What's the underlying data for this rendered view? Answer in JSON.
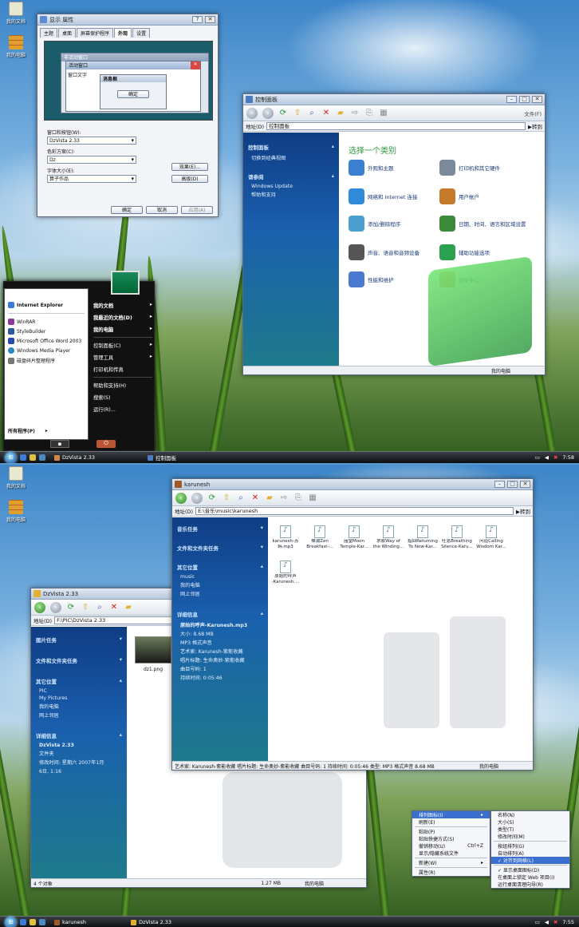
{
  "screen1": {
    "desktop_icons": [
      "我的文档",
      "我的电脑"
    ],
    "display_dialog": {
      "title": "显示 属性",
      "tabs": [
        "主题",
        "桌面",
        "屏幕保护程序",
        "外观",
        "设置"
      ],
      "active_tab": "外观",
      "preview": {
        "inactive": "非活动窗口",
        "active": "活动窗口",
        "text": "窗口文字",
        "msgbox": "消息框",
        "ok": "确定"
      },
      "label_windows": "窗口和按钮(W):",
      "value_windows": "DzVista 2.33",
      "label_scheme": "色彩方案(C):",
      "value_scheme": "Dz",
      "label_font": "字体大小(E):",
      "value_font": "算子作品",
      "btn_effects": "效果(E)...",
      "btn_advanced": "高级(D)",
      "btn_ok": "确定",
      "btn_cancel": "取消",
      "btn_apply": "应用(A)"
    },
    "control_panel": {
      "title": "控制面板",
      "address_label": "地址(D)",
      "address": "控制面板",
      "go": "转到",
      "file_menu": "文件(F)",
      "left_header": "控制面板",
      "switch_view": "切换到经典视图",
      "see_also_header": "请参阅",
      "see_also": [
        "Windows Update",
        "帮助和支持"
      ],
      "heading": "选择一个类别",
      "categories": [
        {
          "label": "外观和主题",
          "color": "#3a7fd0"
        },
        {
          "label": "打印机和其它硬件",
          "color": "#7a8a9a"
        },
        {
          "label": "网络和 Internet 连接",
          "color": "#2f8ad8"
        },
        {
          "label": "用户帐户",
          "color": "#c47a2a"
        },
        {
          "label": "添加/删除程序",
          "color": "#4aa0d0"
        },
        {
          "label": "日期、时间、语言和区域设置",
          "color": "#3a8a3a"
        },
        {
          "label": "声音、语音和音频设备",
          "color": "#555"
        },
        {
          "label": "辅助功能选项",
          "color": "#2aa050"
        },
        {
          "label": "性能和维护",
          "color": "#4a7ad0"
        },
        {
          "label": "安全中心",
          "color": "#d0a030"
        }
      ],
      "status": "我的电脑"
    },
    "start_menu": {
      "pinned": [
        "Internet Explorer"
      ],
      "recent": [
        "WinRAR",
        "StyleBuilder",
        "Microsoft Office Word 2003",
        "Windows Media Player",
        "磁盘碎片整理程序"
      ],
      "all_programs": "所有程序(P)",
      "right": [
        "我的文档",
        "我最近的文档(D)",
        "我的电脑",
        "控制面板(C)",
        "管理工具",
        "打印机和传真",
        "帮助和支持(H)",
        "搜索(S)",
        "运行(R)..."
      ]
    },
    "taskbar": {
      "tasks": [
        "DzVista 2.33",
        "控制面板"
      ],
      "time": "7:58"
    }
  },
  "screen2": {
    "desktop_icons": [
      "我的文档",
      "我的电脑"
    ],
    "music_window": {
      "title": "karunesh",
      "address_label": "地址(D)",
      "address": "E:\\音乐\\music\\karunesh",
      "go": "转到",
      "sections": [
        {
          "header": "音乐任务",
          "items": []
        },
        {
          "header": "文件和文件夹任务",
          "items": []
        },
        {
          "header": "其它位置",
          "items": [
            "music",
            "我的电脑",
            "网上邻居"
          ]
        }
      ],
      "details_header": "详细信息",
      "details_title": "原始的呼声-Karunesh.mp3",
      "details": [
        "大小: 8.68 MB",
        "MP3 格式声音",
        "艺术家: Karunesh-紫能收藏",
        "唱片标题: 生命奥妙-紫能收藏",
        "曲目号码: 1",
        "持续时间: 0:05:46"
      ],
      "files": [
        [
          "karunesh-苏",
          "韩.mp3"
        ],
        [
          "禅潮Zen",
          "Breakfast-..."
        ],
        [
          "庙堂Moon",
          "Temple-Kar..."
        ],
        [
          "求索Way of",
          "the Winding..."
        ],
        [
          "指回Returning",
          "To Now-Kar..."
        ],
        [
          "吐息Breathing",
          "Silence-Karu..."
        ],
        [
          "问道Calling",
          "Wisdom Kar..."
        ],
        [
          "原始的呼声",
          "-Karunesh...."
        ]
      ],
      "status": "艺术家: Karunesh-紫能收藏 唱片标题: 生命奥妙-紫能收藏 曲目号码: 1 持续时间: 0:05:46 类型: MP3 格式声音 8.68 MB",
      "status_right": "我的电脑"
    },
    "pic_window": {
      "title": "DzVista 2.33",
      "address_label": "地址(D)",
      "address": "F:\\PIC\\DzVista 2.33",
      "sections": [
        {
          "header": "图片任务",
          "items": []
        },
        {
          "header": "文件和文件夹任务",
          "items": []
        },
        {
          "header": "其它位置",
          "items": [
            "PIC",
            "My Pictures",
            "我的电脑",
            "网上邻居"
          ]
        }
      ],
      "details_header": "详细信息",
      "details_title": "DzVista 2.33",
      "details": [
        "文件夹",
        "修改时间: 星期六 2007年1月",
        "6日, 1:16"
      ],
      "file": "dz1.png",
      "status_left": "4 个对象",
      "status_size": "1.27 MB",
      "status_right": "我的电脑"
    },
    "context_menu": {
      "items": [
        {
          "label": "排列图标(I)",
          "arrow": true,
          "hl": true
        },
        {
          "label": "刷新(E)"
        },
        {
          "sep": true
        },
        {
          "label": "粘贴(P)"
        },
        {
          "label": "粘贴快捷方式(S)"
        },
        {
          "label": "撤销移动(U)",
          "shortcut": "Ctrl+Z"
        },
        {
          "label": "显示/隐藏系统文件"
        },
        {
          "sep": true
        },
        {
          "label": "新建(W)",
          "arrow": true
        },
        {
          "sep": true
        },
        {
          "label": "属性(R)"
        }
      ]
    },
    "submenu": {
      "items": [
        {
          "label": "名称(N)"
        },
        {
          "label": "大小(S)"
        },
        {
          "label": "类型(T)"
        },
        {
          "label": "修改时间(M)"
        },
        {
          "sep": true
        },
        {
          "label": "按组排列(G)"
        },
        {
          "label": "自动排列(A)"
        },
        {
          "label": "对齐到网格(L)",
          "check": true,
          "hl": true
        },
        {
          "sep": true
        },
        {
          "label": "显示桌面图标(D)",
          "check": true
        },
        {
          "label": "在桌面上锁定 Web 项目(I)"
        },
        {
          "label": "运行桌面清理向导(R)"
        }
      ]
    },
    "taskbar": {
      "tasks": [
        "karunesh",
        "DzVista 2.33"
      ],
      "time": "7:55"
    }
  }
}
